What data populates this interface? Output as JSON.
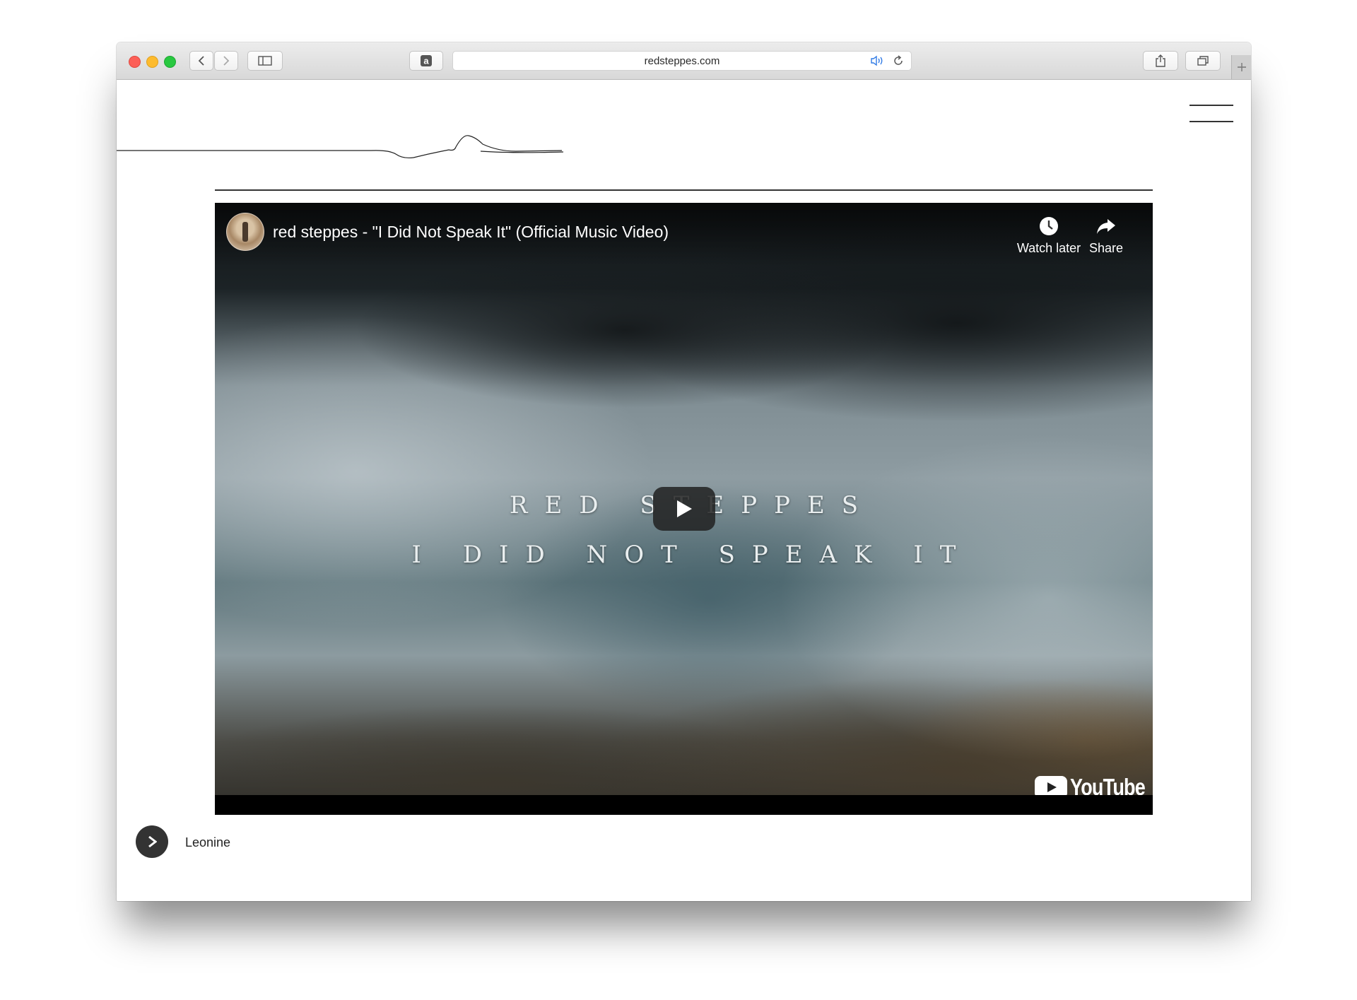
{
  "browser": {
    "url": "redsteppes.com",
    "reader_icon": "amazon-a-icon",
    "icons": [
      "back-icon",
      "forward-icon",
      "sidebar-icon",
      "audio-icon",
      "reload-icon",
      "share-icon",
      "tabs-icon",
      "plus-icon"
    ]
  },
  "site": {
    "logo": "waveform-line-logo",
    "menu_icon": "hamburger-icon"
  },
  "video": {
    "title": "red steppes - \"I Did Not Speak It\" (Official Music Video)",
    "overlay_line1": "RED STEPPES",
    "overlay_line2": "I DID NOT SPEAK IT",
    "watch_later_label": "Watch later",
    "share_label": "Share",
    "brand": "YouTube"
  },
  "audio_player": {
    "track_name": "Leonine"
  },
  "colors": {
    "close": "#fc5f57",
    "minimize": "#fdbb2e",
    "zoom": "#28c840",
    "audio_icon": "#2f7ae5"
  }
}
